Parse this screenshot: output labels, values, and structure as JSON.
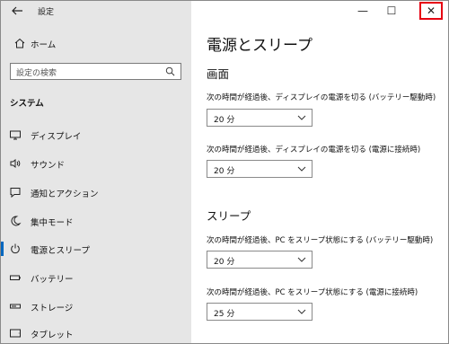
{
  "window": {
    "title": "設定",
    "controls": {
      "minimize": "—",
      "maximize": "☐",
      "close": "✕"
    }
  },
  "sidebar": {
    "home_label": "ホーム",
    "search_placeholder": "設定の検索",
    "section_title": "システム",
    "items": [
      {
        "label": "ディスプレイ",
        "icon": "display-icon"
      },
      {
        "label": "サウンド",
        "icon": "speaker-icon"
      },
      {
        "label": "通知とアクション",
        "icon": "notification-icon"
      },
      {
        "label": "集中モード",
        "icon": "moon-icon"
      },
      {
        "label": "電源とスリープ",
        "icon": "power-icon",
        "selected": true
      },
      {
        "label": "バッテリー",
        "icon": "battery-icon"
      },
      {
        "label": "ストレージ",
        "icon": "storage-icon"
      },
      {
        "label": "タブレット",
        "icon": "tablet-icon"
      }
    ]
  },
  "main": {
    "page_title": "電源とスリープ",
    "screen": {
      "heading": "画面",
      "battery_desc": "次の時間が経過後、ディスプレイの電源を切る (バッテリー駆動時)",
      "battery_value": "20 分",
      "plugged_desc": "次の時間が経過後、ディスプレイの電源を切る (電源に接続時)",
      "plugged_value": "20 分"
    },
    "sleep": {
      "heading": "スリープ",
      "battery_desc": "次の時間が経過後、PC をスリープ状態にする (バッテリー駆動時)",
      "battery_value": "20 分",
      "plugged_desc": "次の時間が経過後、PC をスリープ状態にする (電源に接続時)",
      "plugged_value": "25 分"
    }
  },
  "colors": {
    "sidebar_bg": "#e6e6e6",
    "accent": "#0067c0",
    "close_highlight": "#e60012"
  }
}
